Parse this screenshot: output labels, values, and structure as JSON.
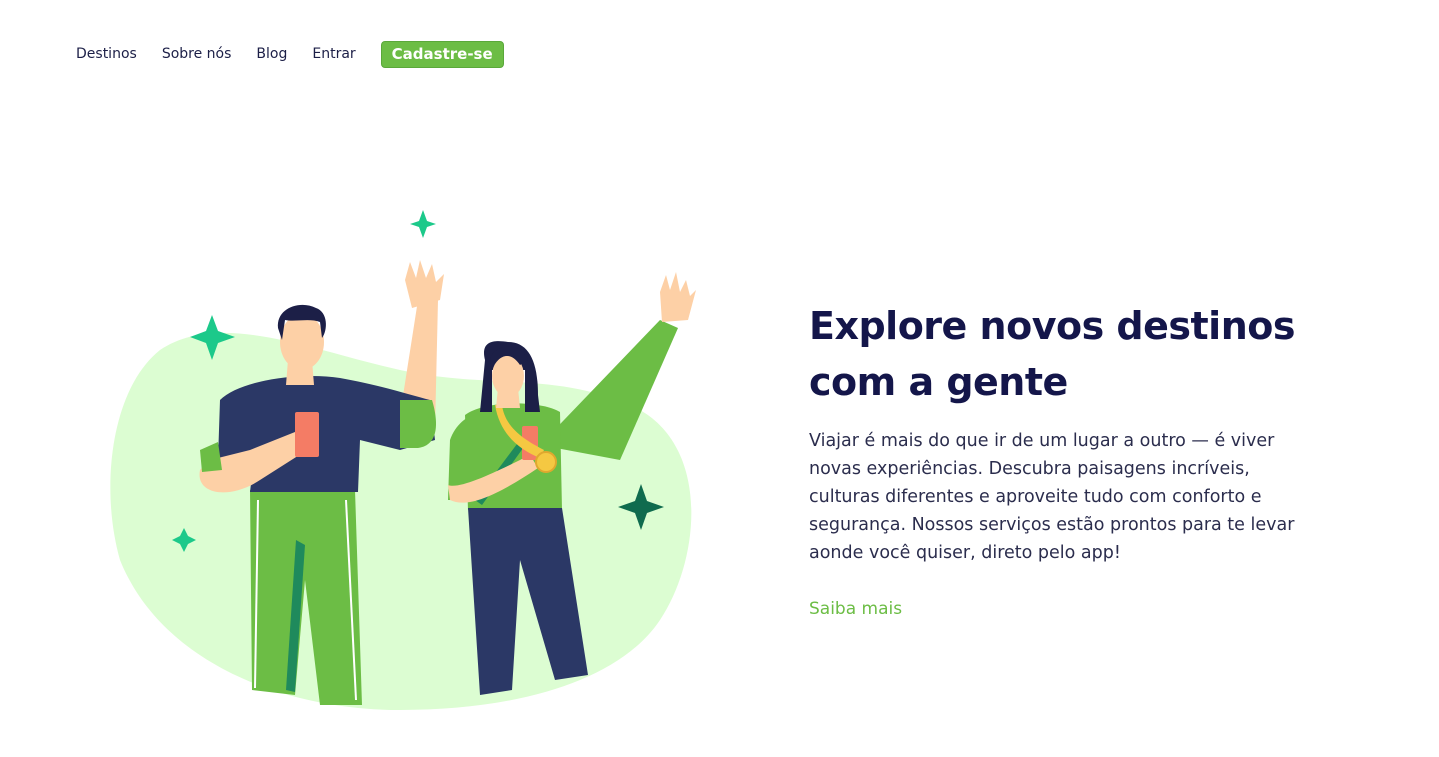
{
  "nav": {
    "items": [
      {
        "label": "Destinos"
      },
      {
        "label": "Sobre nós"
      },
      {
        "label": "Blog"
      },
      {
        "label": "Entrar"
      }
    ],
    "signup_label": "Cadastre-se"
  },
  "hero": {
    "title": "Explore novos destinos com a gente",
    "description": "Viajar é mais do que ir de um lugar a outro — é viver novas experiências. Descubra paisagens incríveis, culturas diferentes e aproveite tudo com conforto e segurança. Nossos serviços estão prontos para te levar aonde você quiser, direto pelo app!",
    "link_label": "Saiba mais"
  },
  "colors": {
    "accent": "#6cbd45",
    "heading": "#14164a",
    "blob": "#dcfdd2",
    "navy": "#2b3866",
    "sparkle": "#1cc98a",
    "sparkle_dark": "#0f6b4e"
  }
}
